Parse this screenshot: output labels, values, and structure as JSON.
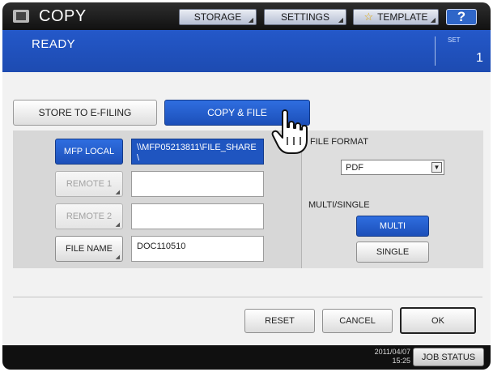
{
  "header": {
    "app_title": "COPY",
    "app_icon": "copy-icon",
    "storage_label": "STORAGE",
    "settings_label": "SETTINGS",
    "template_label": "TEMPLATE",
    "template_icon": "star-icon",
    "help_label": "?"
  },
  "status": {
    "text": "READY",
    "set_label": "SET",
    "set_value": "1"
  },
  "tabs": {
    "store_label": "STORE TO E-FILING",
    "copy_file_label": "COPY & FILE"
  },
  "destinations": {
    "mfp_local_label": "MFP LOCAL",
    "mfp_local_value": "\\\\MFP05213811\\FILE_SHARE\\",
    "remote1_label": "REMOTE 1",
    "remote1_value": "",
    "remote2_label": "REMOTE 2",
    "remote2_value": "",
    "file_name_label": "FILE NAME",
    "file_name_value": "DOC110510"
  },
  "format": {
    "file_format_label": "FILE FORMAT",
    "file_format_value": "PDF",
    "multi_single_label": "MULTI/SINGLE",
    "multi_label": "MULTI",
    "single_label": "SINGLE"
  },
  "actions": {
    "reset_label": "RESET",
    "cancel_label": "CANCEL",
    "ok_label": "OK"
  },
  "footer": {
    "date": "2011/04/07",
    "time": "15:25",
    "job_status_label": "JOB STATUS"
  },
  "colors": {
    "accent_blue": "#1f55c0",
    "status_bar": "#2458c9",
    "topbar": "#1a1a1a"
  }
}
